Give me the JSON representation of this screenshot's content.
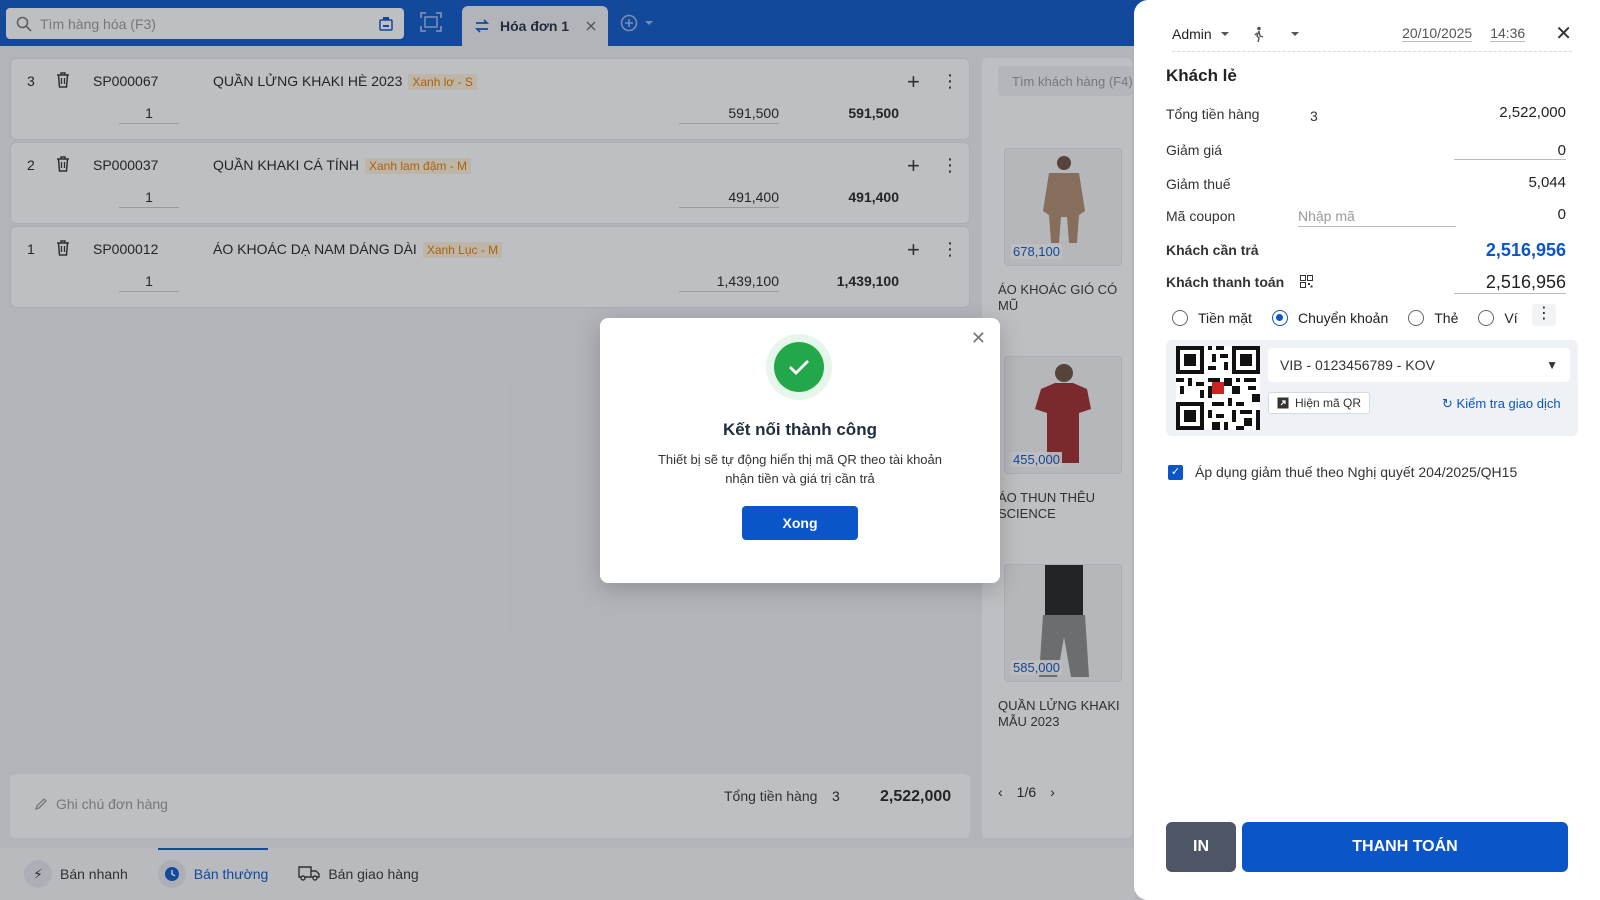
{
  "search": {
    "placeholder": "Tìm hàng hóa (F3)"
  },
  "tabs": [
    {
      "label": "Hóa đơn 1"
    }
  ],
  "cart": [
    {
      "idx": "3",
      "code": "SP000067",
      "name": "QUẦN LỬNG KHAKI HÈ 2023",
      "variant": "Xanh lơ - S",
      "qty": "1",
      "price": "591,500",
      "total": "591,500"
    },
    {
      "idx": "2",
      "code": "SP000037",
      "name": "QUẦN KHAKI CÁ TÍNH",
      "variant": "Xanh lam đậm - M",
      "qty": "1",
      "price": "491,400",
      "total": "491,400"
    },
    {
      "idx": "1",
      "code": "SP000012",
      "name": "ÁO KHOÁC DẠ NAM DÁNG DÀI",
      "variant": "Xanh Lục - M",
      "qty": "1",
      "price": "1,439,100",
      "total": "1,439,100"
    }
  ],
  "products": {
    "search_placeholder": "Tìm khách hàng (F4)",
    "items": [
      {
        "price": "678,100",
        "name": "ÁO KHOÁC GIÓ CÓ MŨ"
      },
      {
        "price": "455,000",
        "name": "ÁO THUN THÊU SCIENCE"
      },
      {
        "price": "585,000",
        "name": "QUẦN LỬNG KHAKI MẪU 2023"
      }
    ],
    "page": "1/6"
  },
  "footer": {
    "note_placeholder": "Ghi chú đơn hàng",
    "sum_label": "Tổng tiền hàng",
    "sum_count": "3",
    "sum_value": "2,522,000"
  },
  "bottom_nav": [
    {
      "label": "Bán nhanh"
    },
    {
      "label": "Bán thường"
    },
    {
      "label": "Bán giao hàng"
    }
  ],
  "panel": {
    "user": "Admin",
    "date": "20/10/2025",
    "time": "14:36",
    "customer": "Khách lẻ",
    "total_label": "Tổng tiền hàng",
    "total_count": "3",
    "total_value": "2,522,000",
    "discount_label": "Giảm giá",
    "discount_value": "0",
    "tax_label": "Giảm thuế",
    "tax_value": "5,044",
    "coupon_label": "Mã coupon",
    "coupon_placeholder": "Nhập mã",
    "coupon_value": "0",
    "due_label": "Khách cần trả",
    "due_value": "2,516,956",
    "paid_label": "Khách thanh toán",
    "paid_value": "2,516,956",
    "methods": [
      "Tiền mặt",
      "Chuyển khoản",
      "Thẻ",
      "Ví"
    ],
    "bank": "VIB - 0123456789 - KOV",
    "show_qr": "Hiện mã QR",
    "check_tx": "Kiểm tra giao dịch",
    "vat_note": "Áp dụng giảm thuế theo Nghị quyết 204/2025/QH15",
    "print_label": "IN",
    "pay_label": "THANH TOÁN"
  },
  "modal": {
    "title": "Kết nối thành công",
    "message": "Thiết bị sẽ tự động hiển thị mã QR theo tài khoản nhận tiền và giá trị cần trả",
    "done_label": "Xong"
  },
  "colors": {
    "brand": "#0a56c8",
    "success": "#22a84a",
    "variant": "#e07b00"
  }
}
